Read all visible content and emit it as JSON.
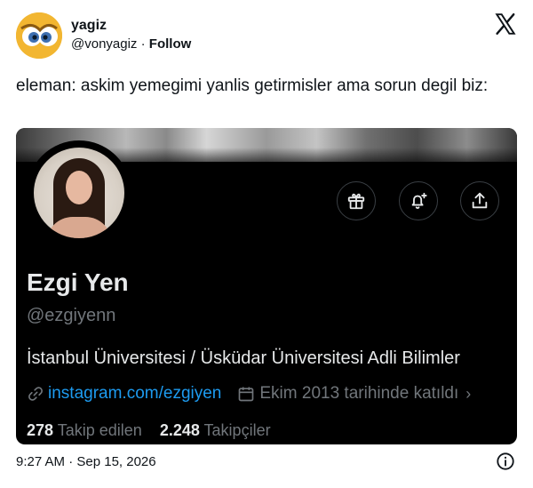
{
  "author": {
    "display_name": "yagiz",
    "handle": "@vonyagiz",
    "separator": "·",
    "follow_label": "Follow"
  },
  "tweet": {
    "text": "eleman: askim yemegimi yanlis getirmisler ama sorun degil biz:",
    "timestamp": "9:27 AM · Sep 15, 2026"
  },
  "profile_card": {
    "name": "Ezgi Yen",
    "handle": "@ezgiyenn",
    "bio": "İstanbul Üniversitesi / Üsküdar Üniversitesi Adli Bilimler",
    "link": "instagram.com/ezgiyen",
    "joined": "Ekim 2013 tarihinde katıldı",
    "following_count": "278",
    "following_label": "Takip edilen",
    "followers_count": "2.248",
    "followers_label": "Takipçiler"
  },
  "colors": {
    "link_blue": "#1d9bf0",
    "card_bg": "#000000",
    "muted": "#71767b",
    "avatar_yellow": "#f2b631"
  },
  "icons": [
    "owl-avatar-icon",
    "x-logo-icon",
    "gift-icon",
    "bell-plus-icon",
    "share-icon",
    "link-icon",
    "calendar-icon",
    "chevron-right-icon",
    "info-icon"
  ]
}
